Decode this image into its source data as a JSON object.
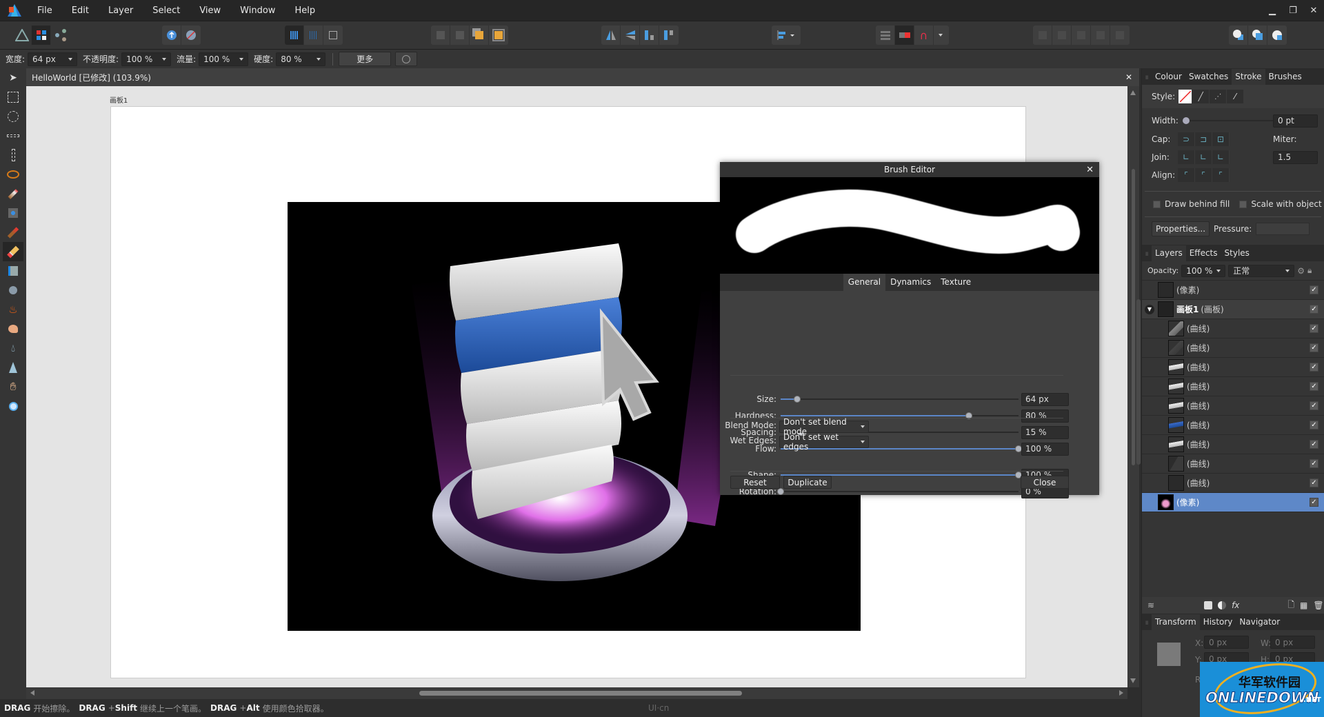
{
  "menu": {
    "items": [
      "File",
      "Edit",
      "Layer",
      "Select",
      "View",
      "Window",
      "Help"
    ]
  },
  "window_controls": {
    "minimize": "minimize-icon",
    "restore": "restore-icon",
    "close": "close-icon"
  },
  "context_bar": {
    "width_label": "宽度:",
    "width_value": "64 px",
    "opacity_label": "不透明度:",
    "opacity_value": "100 %",
    "flow_label": "流量:",
    "flow_value": "100 %",
    "hardness_label": "硬度:",
    "hardness_value": "80 %",
    "more_label": "更多"
  },
  "document": {
    "tab_title": "HelloWorld [已修改] (103.9%)",
    "artboard_label": "画板1"
  },
  "status": {
    "k1": "DRAG",
    "t1": "开始擦除。",
    "k2": "DRAG",
    "plus2": "+",
    "k2b": "Shift",
    "t2": "继续上一个笔画。",
    "k3": "DRAG",
    "plus3": "+",
    "k3b": "Alt",
    "t3": "使用颜色拾取器。",
    "watermark": "UI·cn"
  },
  "brush_editor": {
    "title": "Brush Editor",
    "tabs": [
      "General",
      "Dynamics",
      "Texture"
    ],
    "active_tab": "General",
    "sliders": [
      {
        "label": "Size:",
        "value": "64 px",
        "fraction": 0.07
      },
      {
        "label": "Hardness:",
        "value": "80 %",
        "fraction": 0.79
      },
      {
        "label": "Spacing:",
        "value": "15 %",
        "fraction": 0.085
      },
      {
        "label": "Flow:",
        "value": "100 %",
        "fraction": 1.0
      },
      {
        "label": "Shape:",
        "value": "100 %",
        "fraction": 1.0
      },
      {
        "label": "Rotation:",
        "value": "0 %",
        "fraction": 0.0
      }
    ],
    "blend_mode_label": "Blend Mode:",
    "blend_mode_value": "Don't set blend mode",
    "wet_edges_label": "Wet Edges:",
    "wet_edges_value": "Don't set wet edges",
    "reset": "Reset",
    "duplicate": "Duplicate",
    "close": "Close"
  },
  "stroke_panel": {
    "tabs": [
      "Colour",
      "Swatches",
      "Stroke",
      "Brushes"
    ],
    "active_tab": "Stroke",
    "style_label": "Style:",
    "width_label": "Width:",
    "width_value": "0 pt",
    "cap_label": "Cap:",
    "join_label": "Join:",
    "align_label": "Align:",
    "miter_label": "Miter:",
    "miter_value": "1.5",
    "draw_behind_fill": "Draw behind fill",
    "scale_with_object": "Scale with object",
    "properties_label": "Properties...",
    "pressure_label": "Pressure:"
  },
  "layers_panel": {
    "tabs": [
      "Layers",
      "Effects",
      "Styles"
    ],
    "active_tab": "Layers",
    "opacity_label": "Opacity:",
    "opacity_value": "100 %",
    "blend_value": "正常",
    "layers": [
      {
        "name": "(像素)",
        "indent": 0,
        "thumb": "empty",
        "selected": false
      },
      {
        "name": "画板1",
        "suffix": "(画板)",
        "indent": 0,
        "thumb": "artboard",
        "expanded": true,
        "selected": false
      },
      {
        "name": "(曲线)",
        "indent": 1,
        "thumb": "cursor-light",
        "selected": false
      },
      {
        "name": "(曲线)",
        "indent": 1,
        "thumb": "cursor-dark",
        "selected": false
      },
      {
        "name": "(曲线)",
        "indent": 1,
        "thumb": "white-bar",
        "selected": false
      },
      {
        "name": "(曲线)",
        "indent": 1,
        "thumb": "white-bar",
        "selected": false
      },
      {
        "name": "(曲线)",
        "indent": 1,
        "thumb": "white-bar",
        "selected": false
      },
      {
        "name": "(曲线)",
        "indent": 1,
        "thumb": "blue-bar",
        "selected": false
      },
      {
        "name": "(曲线)",
        "indent": 1,
        "thumb": "white-bar",
        "selected": false
      },
      {
        "name": "(曲线)",
        "indent": 1,
        "thumb": "dark-shape",
        "selected": false
      },
      {
        "name": "(曲线)",
        "indent": 1,
        "thumb": "empty",
        "selected": false
      },
      {
        "name": "(像素)",
        "indent": 0,
        "thumb": "image",
        "selected": true
      }
    ]
  },
  "transform_panel": {
    "tabs": [
      "Transform",
      "History",
      "Navigator"
    ],
    "active_tab": "Transform",
    "x_label": "X:",
    "x_value": "0 px",
    "y_label": "Y:",
    "y_value": "0 px",
    "w_label": "W:",
    "w_value": "0 px",
    "h_label": "H:",
    "h_value": "0 px",
    "r_label": "R"
  },
  "watermark_badge": {
    "line1": "华军软件园",
    "line2": "ONLINEDOWN",
    ".net": ".NET"
  },
  "colors": {
    "accent": "#5e88c8",
    "panel": "#353535",
    "canvas_bg": "#e4e4e4",
    "menu_bg": "#262626"
  }
}
